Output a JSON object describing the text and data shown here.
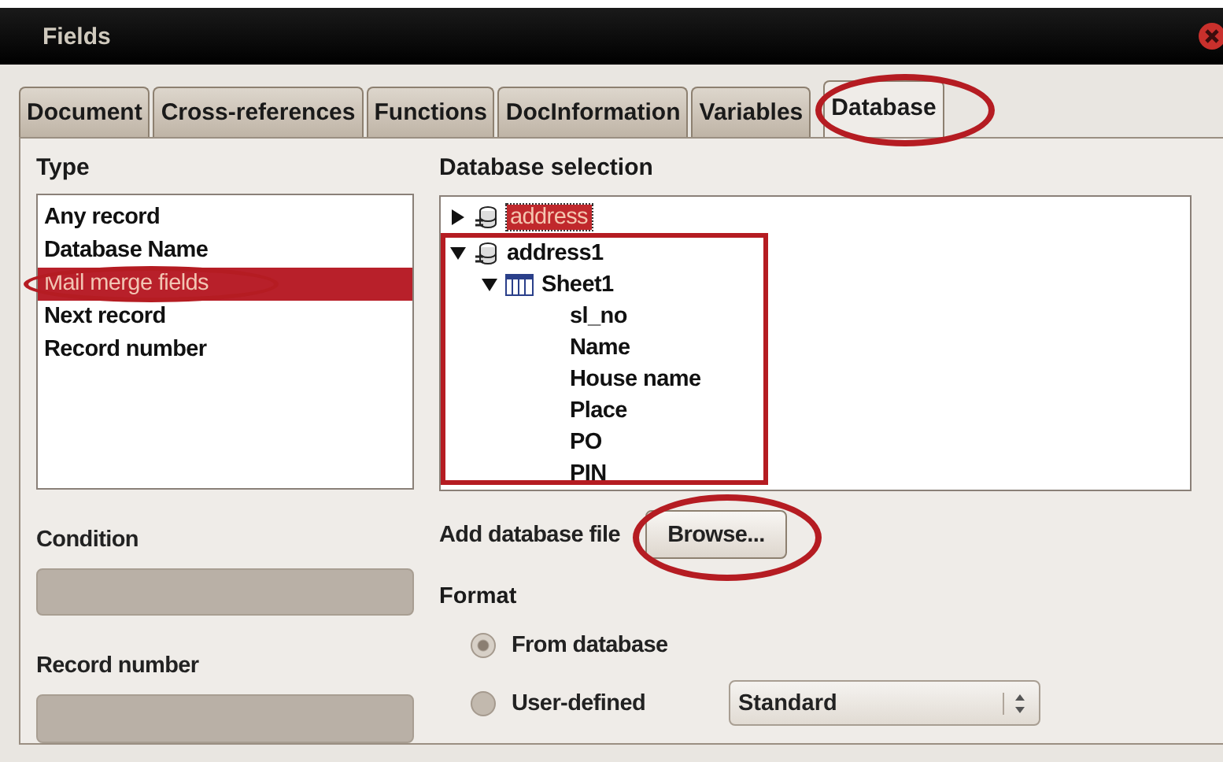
{
  "window": {
    "title": "Fields"
  },
  "tabs": [
    {
      "label": "Document",
      "selected": false,
      "annotated": false
    },
    {
      "label": "Cross-references",
      "selected": false,
      "annotated": false
    },
    {
      "label": "Functions",
      "selected": false,
      "annotated": false
    },
    {
      "label": "DocInformation",
      "selected": false,
      "annotated": false
    },
    {
      "label": "Variables",
      "selected": false,
      "annotated": false
    },
    {
      "label": "Database",
      "selected": true,
      "annotated": true
    }
  ],
  "type": {
    "label": "Type",
    "items": [
      {
        "label": "Any record",
        "selected": false,
        "annotated": false
      },
      {
        "label": "Database Name",
        "selected": false,
        "annotated": false
      },
      {
        "label": "Mail merge fields",
        "selected": true,
        "annotated": true
      },
      {
        "label": "Next record",
        "selected": false,
        "annotated": false
      },
      {
        "label": "Record number",
        "selected": false,
        "annotated": false
      }
    ]
  },
  "database_selection": {
    "label": "Database selection",
    "tree": [
      {
        "label": "address",
        "expanded": false,
        "selected": true,
        "annotated": false
      },
      {
        "label": "address1",
        "expanded": true,
        "selected": false,
        "annotated": true,
        "children": [
          {
            "label": "Sheet1",
            "expanded": true,
            "children": [
              {
                "label": "sl_no"
              },
              {
                "label": "Name"
              },
              {
                "label": "House name"
              },
              {
                "label": "Place"
              },
              {
                "label": "PO"
              },
              {
                "label": "PIN"
              }
            ]
          }
        ]
      }
    ]
  },
  "add_database_file": {
    "label": "Add database file",
    "button": "Browse...",
    "annotated": true
  },
  "condition": {
    "label": "Condition",
    "disabled": true
  },
  "record_number": {
    "label": "Record number",
    "disabled": true
  },
  "format": {
    "label": "Format",
    "options": [
      {
        "label": "From database",
        "selected": true
      },
      {
        "label": "User-defined",
        "selected": false
      }
    ],
    "dropdown": "Standard"
  }
}
